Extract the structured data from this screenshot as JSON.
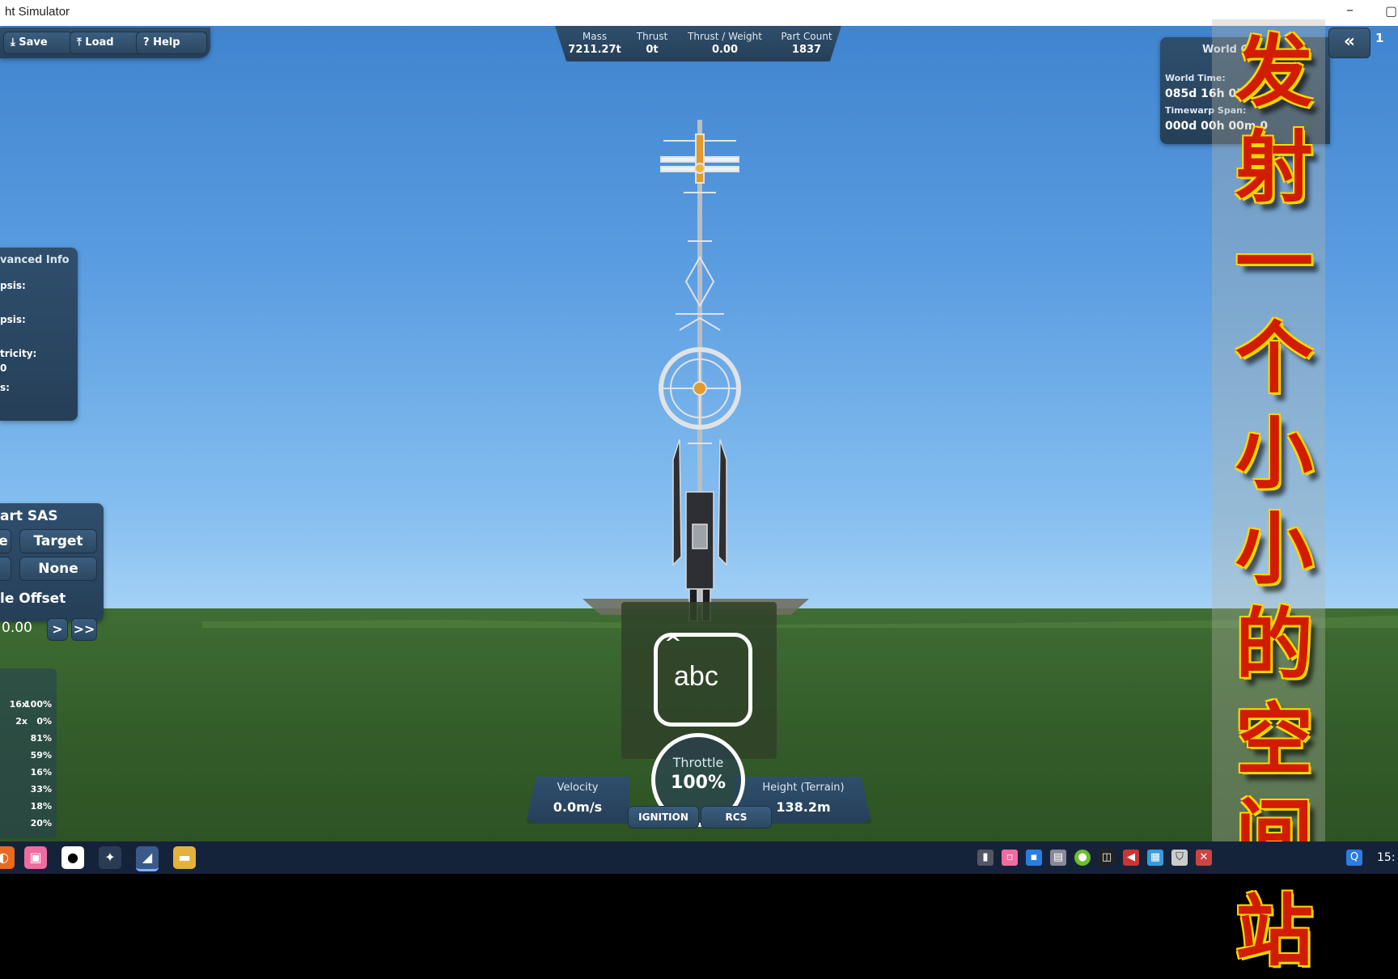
{
  "window": {
    "title": "ht Simulator",
    "minimize_glyph": "–",
    "maximize_glyph": "▢"
  },
  "toolbar": {
    "save_label": "Save",
    "load_label": "Load",
    "help_label": "Help",
    "save_icon": "download-icon",
    "load_icon": "upload-icon",
    "help_icon": "question-icon"
  },
  "stats": [
    {
      "label": "Mass",
      "value": "7211.27t"
    },
    {
      "label": "Thrust",
      "value": "0t"
    },
    {
      "label": "Thrust / Weight",
      "value": "0.00"
    },
    {
      "label": "Part Count",
      "value": "1837"
    }
  ],
  "world_clock": {
    "header": "World Clo",
    "world_time_label": "World Time:",
    "world_time_value": "085d 16h 05",
    "timewarp_label": "Timewarp Span:",
    "timewarp_value": "000d 00h 00m 0",
    "collapse_glyph": "«",
    "corner_text": "1"
  },
  "advanced_info": {
    "header": "vanced Info",
    "rows": [
      "psis:",
      "psis:",
      "tricity:",
      "0",
      "s:"
    ]
  },
  "smart_sas": {
    "header": "art SAS",
    "btn_left_1": "e",
    "btn_target": "Target",
    "btn_left_2": "",
    "btn_none": "None",
    "offset_label": "le Offset",
    "offset_value": "0.00",
    "step_small": ">",
    "step_large": ">>"
  },
  "stage_panel": {
    "rows": [
      {
        "left": "16x",
        "right": "100%"
      },
      {
        "left": "2x",
        "right": "0%"
      },
      {
        "left": "",
        "right": "81%"
      },
      {
        "left": "",
        "right": "59%"
      },
      {
        "left": "",
        "right": "16%"
      },
      {
        "left": "",
        "right": "33%"
      },
      {
        "left": "",
        "right": "18%"
      },
      {
        "left": "",
        "right": "20%"
      }
    ]
  },
  "keyboard": {
    "label": "abc",
    "caret": "^"
  },
  "hud": {
    "velocity_label": "Velocity",
    "velocity_value": "0.0m/s",
    "throttle_label": "Throttle",
    "throttle_value": "100%",
    "height_label": "Height (Terrain)",
    "height_value": "138.2m",
    "ignition_label": "IGNITION",
    "rcs_label": "RCS"
  },
  "caption": "发射一个小小的空间站",
  "taskbar": {
    "apps": [
      "browser-icon",
      "bilibili-icon",
      "qq-icon",
      "settings-icon",
      "simulator-icon",
      "folder-icon"
    ],
    "tray": [
      "usb-icon",
      "bilibili-tray-icon",
      "wechat-tray-icon",
      "network-icon",
      "green-app-icon",
      "display-icon",
      "volume-icon",
      "app-tray-icon",
      "security-icon",
      "tray-app-icon",
      "search-tray-icon"
    ],
    "clock": "15:"
  }
}
